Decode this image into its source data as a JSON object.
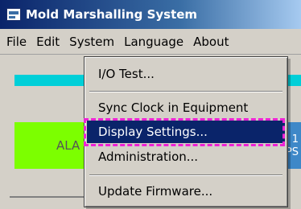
{
  "window": {
    "title": "Mold Marshalling System"
  },
  "menubar": {
    "items": [
      "File",
      "Edit",
      "System",
      "Language",
      "About"
    ]
  },
  "background": {
    "alarm_label": "ALA",
    "blue_box_line1": "1",
    "blue_box_line2": "PS"
  },
  "system_menu": {
    "items": [
      "I/O Test...",
      "Sync Clock in Equipment",
      "Display Settings...",
      "Administration...",
      "Update Firmware..."
    ],
    "selected": "Display Settings..."
  },
  "colors": {
    "title_bar": "#0a246a",
    "selection": "#0a246a",
    "highlight_dash": "#ee22d6",
    "cyan_bar": "#00cfd8",
    "alarm_green": "#7cff00",
    "status_blue": "#3e88c8"
  },
  "icons": {
    "app": "app-window-icon"
  }
}
